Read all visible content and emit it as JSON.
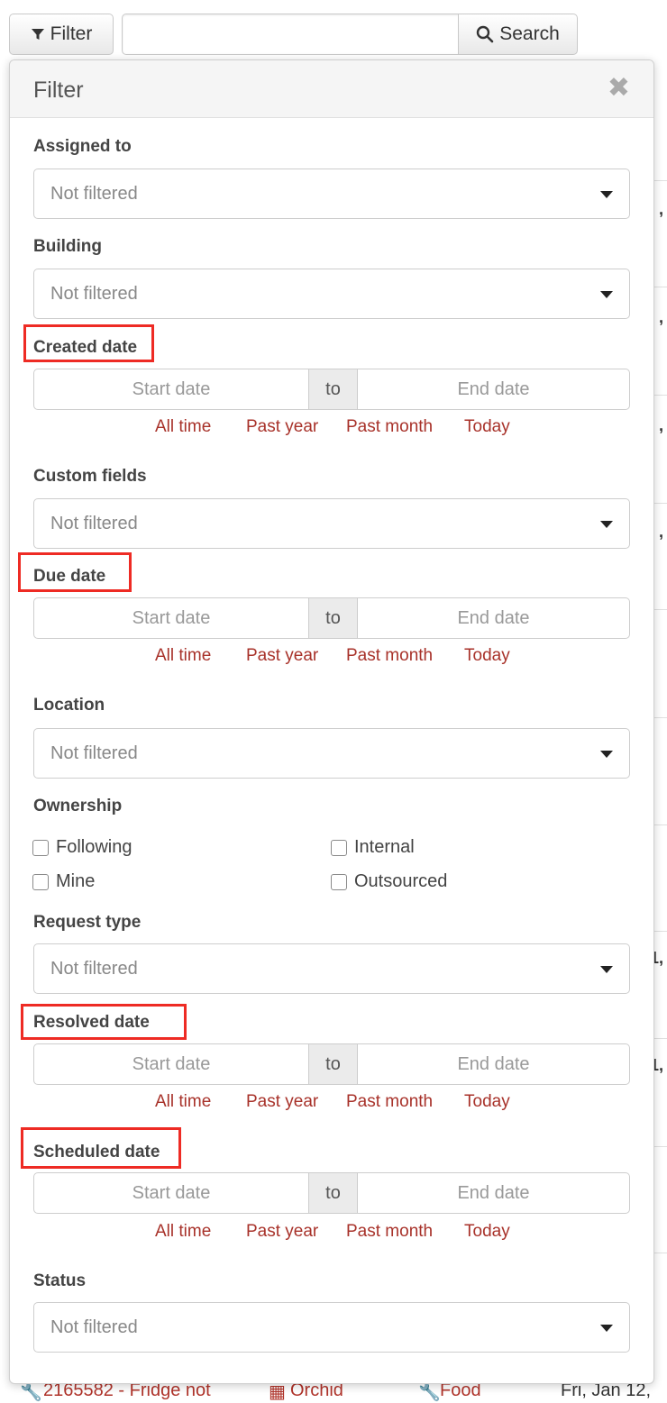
{
  "toolbar": {
    "filter_label": "Filter",
    "search_label": "Search",
    "search_value": ""
  },
  "background": {
    "row_text": {
      "request": "2165582 - Fridge not",
      "building": "Orchid",
      "type": "Food",
      "date": "Fri, Jan 12,"
    },
    "edge_marks": [
      ",",
      ",",
      ",",
      ",",
      "1,",
      "1,"
    ]
  },
  "filter": {
    "title": "Filter",
    "assigned_to": {
      "label": "Assigned to",
      "value": "Not filtered"
    },
    "building": {
      "label": "Building",
      "value": "Not filtered"
    },
    "created_date": {
      "label": "Created date"
    },
    "custom_fields": {
      "label": "Custom fields",
      "value": "Not filtered"
    },
    "due_date": {
      "label": "Due date"
    },
    "location": {
      "label": "Location",
      "value": "Not filtered"
    },
    "ownership": {
      "label": "Ownership",
      "options": [
        "Following",
        "Internal",
        "Mine",
        "Outsourced"
      ]
    },
    "request_type": {
      "label": "Request type",
      "value": "Not filtered"
    },
    "resolved_date": {
      "label": "Resolved date"
    },
    "scheduled_date": {
      "label": "Scheduled date"
    },
    "status": {
      "label": "Status",
      "value": "Not filtered"
    },
    "date_range": {
      "start": "Start date",
      "to": "to",
      "end": "End date"
    },
    "quick_ranges": [
      "All time",
      "Past year",
      "Past month",
      "Today"
    ]
  },
  "colors": {
    "link": "#a8322a",
    "highlight": "#ee2b24"
  }
}
